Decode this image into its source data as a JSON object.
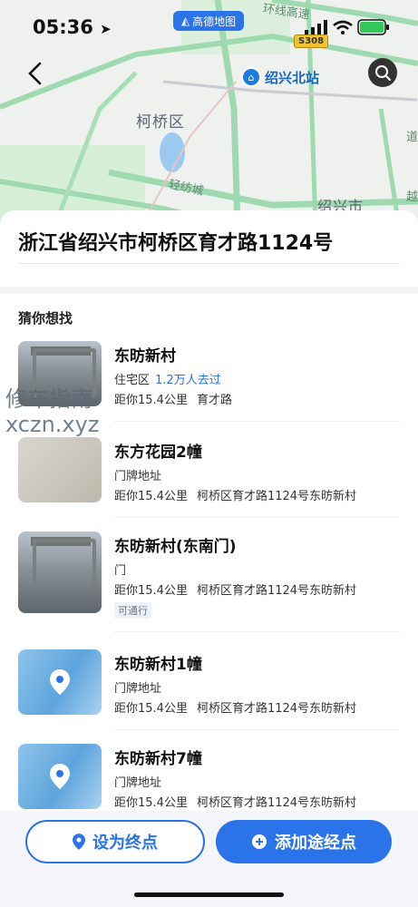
{
  "status": {
    "time": "05:36",
    "app_badge": "高德地图",
    "road_shield": "S308"
  },
  "map": {
    "district": "柯桥区",
    "station": "绍兴北站",
    "city_label": "绍兴市",
    "road_label": "轻纺城",
    "top_road": "环线高速",
    "side_text": "道",
    "side_text2": "越"
  },
  "address": {
    "title": "浙江省绍兴市柯桥区育才路1124号"
  },
  "guess": {
    "title": "猜你想找",
    "items": [
      {
        "name": "东昉新村",
        "type": "住宅区",
        "visits": "1.2万人去过",
        "distance": "距你15.4公里",
        "addr": "育才路",
        "thumb": "photo"
      },
      {
        "name": "东方花园2幢",
        "type": "门牌地址",
        "distance": "距你15.4公里",
        "addr": "柯桥区育才路1124号东昉新村",
        "thumb": "wall"
      },
      {
        "name": "东昉新村(东南门)",
        "type": "门",
        "distance": "距你15.4公里",
        "addr": "柯桥区育才路1124号东昉新村",
        "tag": "可通行",
        "thumb": "photo"
      },
      {
        "name": "东昉新村1幢",
        "type": "门牌地址",
        "distance": "距你15.4公里",
        "addr": "柯桥区育才路1124号东昉新村",
        "thumb": "map"
      },
      {
        "name": "东昉新村7幢",
        "type": "门牌地址",
        "distance": "距你15.4公里",
        "addr": "柯桥区育才路1124号东昉新村",
        "thumb": "map"
      }
    ]
  },
  "watermark": {
    "line1": "修车指南",
    "line2": "xczn.xyz"
  },
  "actions": {
    "set_destination": "设为终点",
    "add_waypoint": "添加途经点"
  },
  "colors": {
    "accent": "#2a73e8",
    "map_road_green": "#8fd6a4"
  }
}
